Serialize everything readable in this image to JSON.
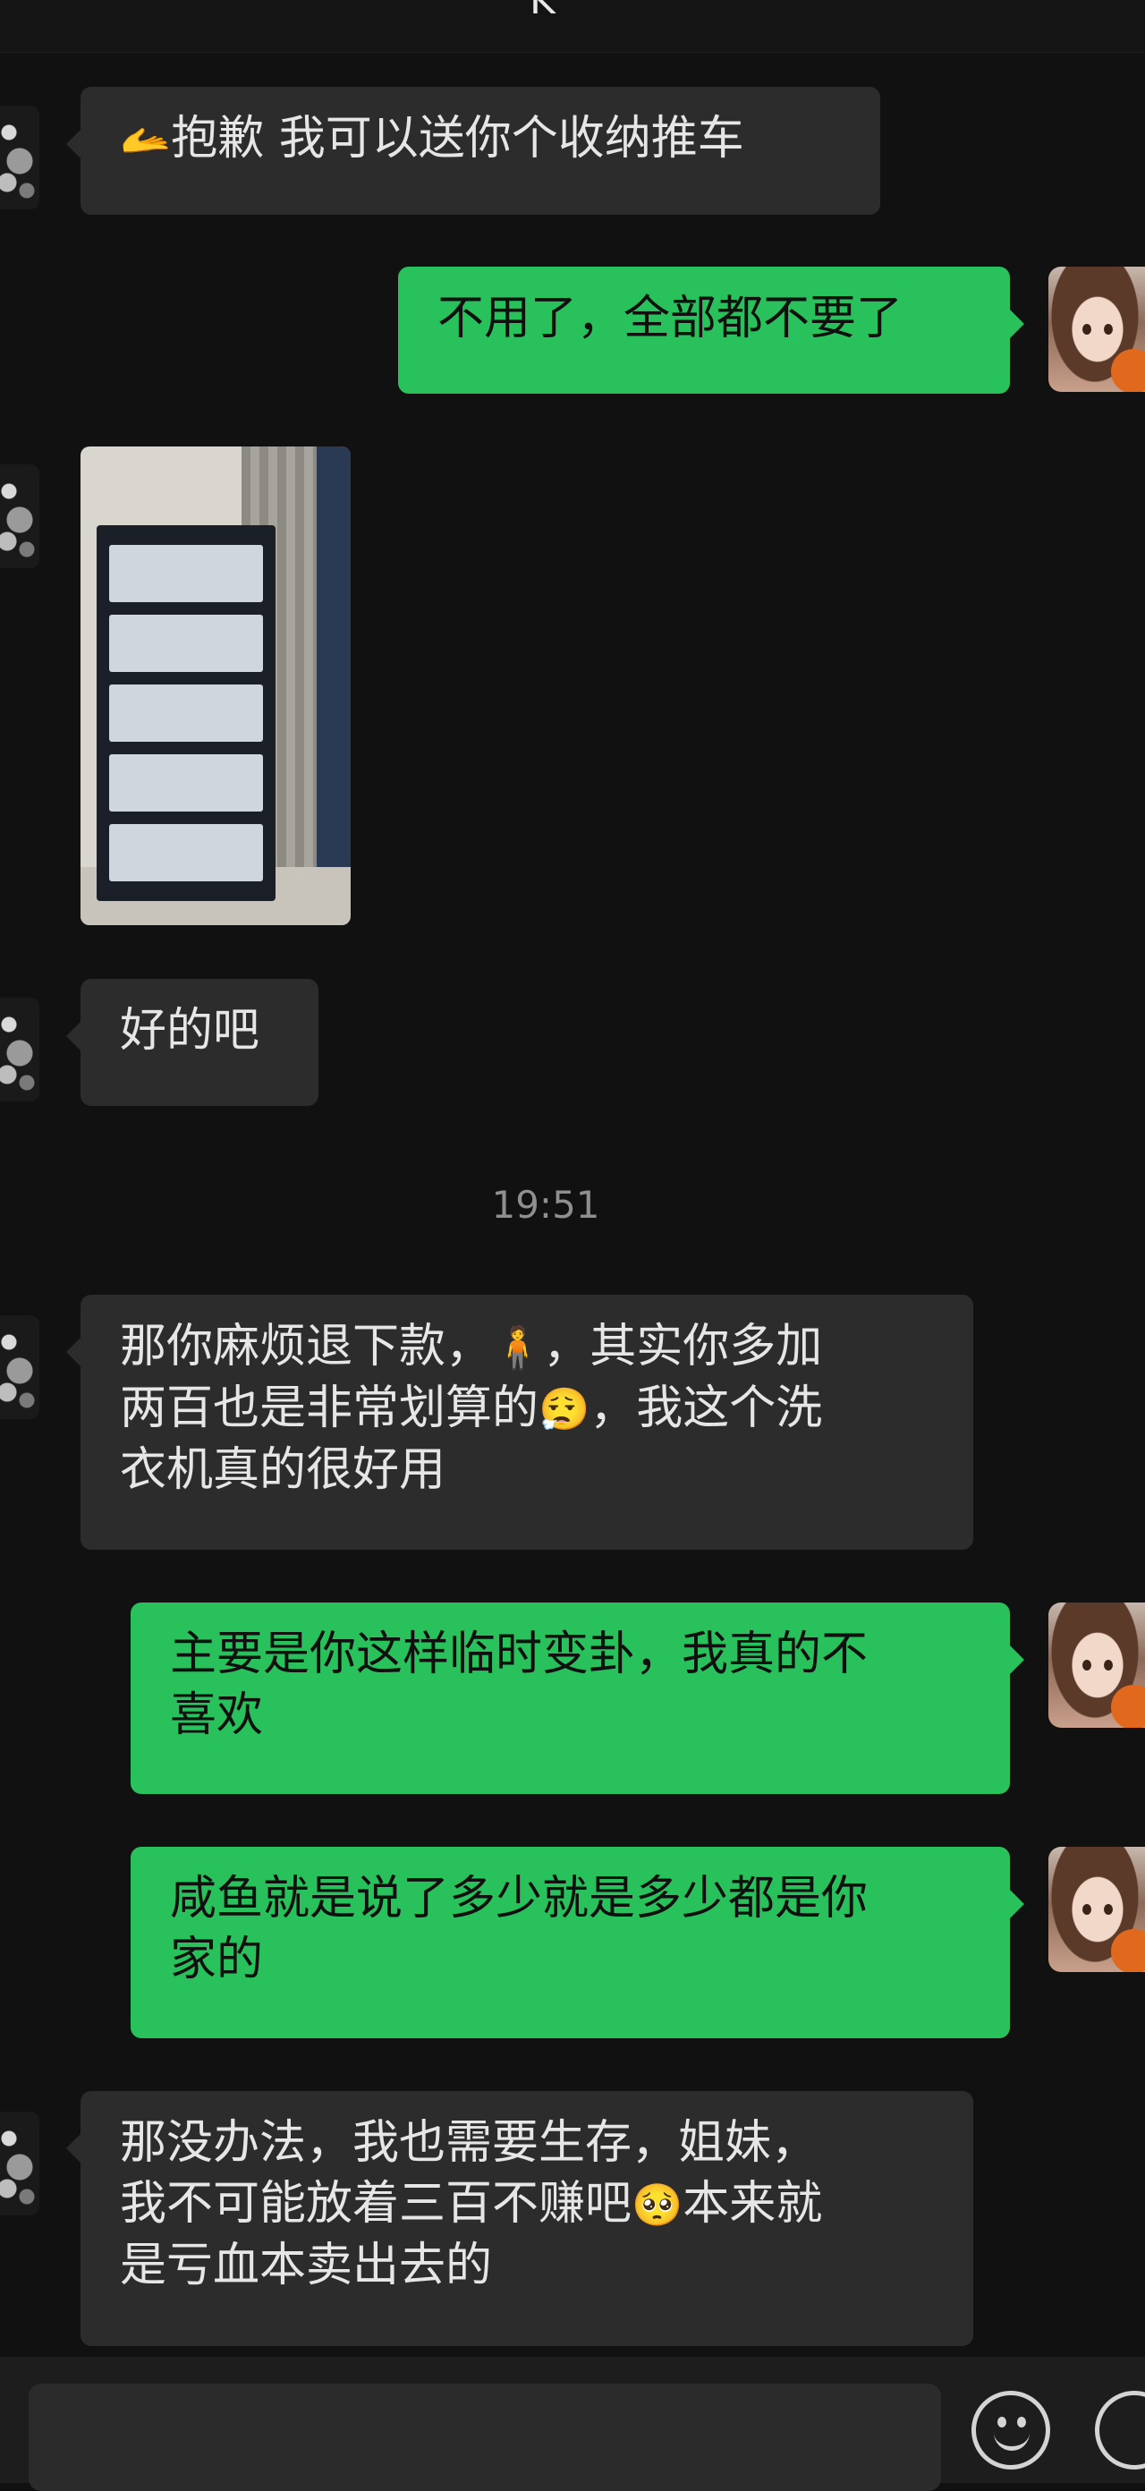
{
  "header": {
    "partial_title": "K"
  },
  "messages": [
    {
      "side": "in",
      "emoji": "🫴",
      "text": "抱歉 我可以送你个收纳推车"
    },
    {
      "side": "out",
      "text": "不用了，全部都不要了"
    },
    {
      "side": "in",
      "type": "image"
    },
    {
      "side": "in",
      "text": "好的吧"
    },
    {
      "side": "in",
      "text1": "那你麻烦退下款，",
      "emoji1": "🧍",
      "text2": "，其实你多加",
      "text3": "两百也是非常划算的",
      "emoji2": "😮‍💨",
      "text4": "，我这个洗",
      "text5": "衣机真的很好用"
    },
    {
      "side": "out",
      "text1": "主要是你这样临时变卦，我真的不",
      "text2": "喜欢"
    },
    {
      "side": "out",
      "text1": "咸鱼就是说了多少就是多少都是你",
      "text2": "家的"
    },
    {
      "side": "in",
      "text1": "那没办法，我也需要生存，姐妹，",
      "text2": "我不可能放着三百不赚吧",
      "emoji": "🥺",
      "text3": "本来就",
      "text4": "是亏血本卖出去的"
    }
  ],
  "timestamp": "19:51",
  "input": {
    "placeholder": ""
  },
  "colors": {
    "incoming": "#2c2c2c",
    "outgoing": "#29c15b",
    "background": "#111111"
  },
  "icons": [
    "emoji-icon",
    "plus-icon"
  ]
}
